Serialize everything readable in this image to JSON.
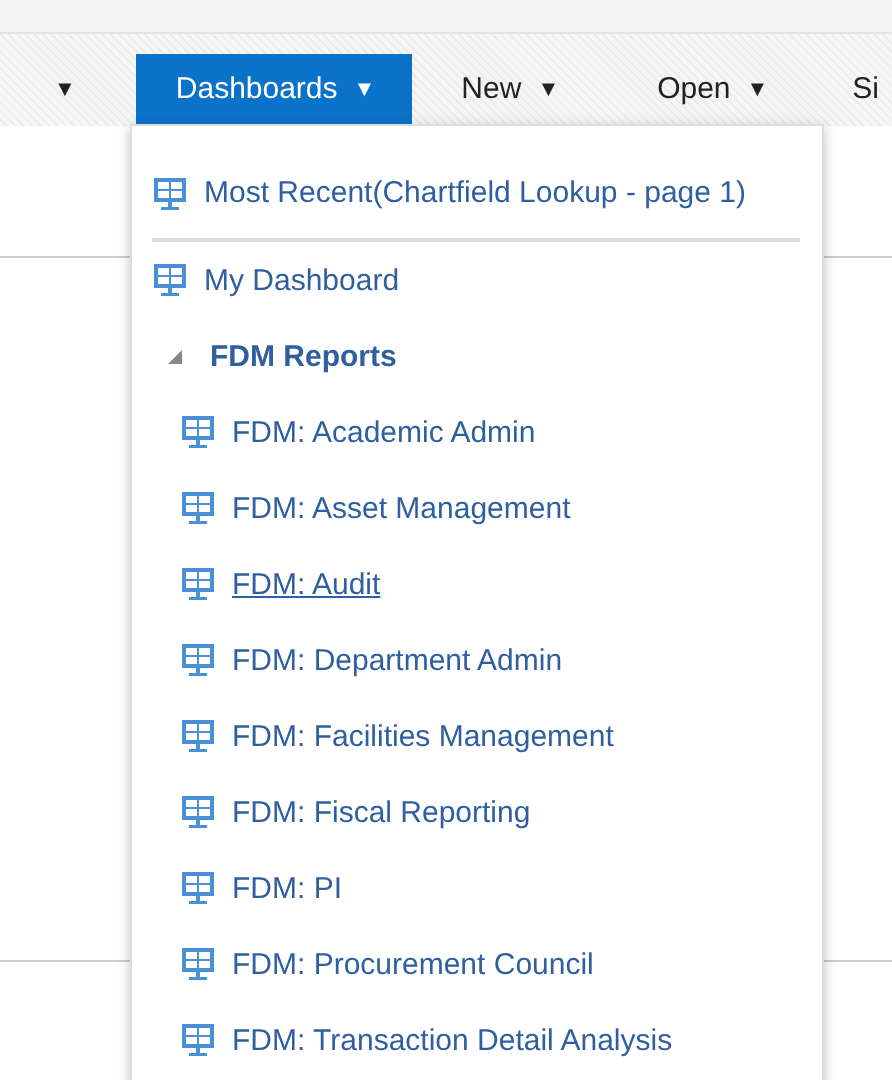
{
  "toolbar": {
    "items": [
      {
        "caret": "▼",
        "selected": false
      },
      {
        "label": "Dashboards",
        "caret": "▼",
        "selected": true
      },
      {
        "label": "New",
        "caret": "▼",
        "selected": false
      },
      {
        "label": "Open",
        "caret": "▼",
        "selected": false
      },
      {
        "label": "Si",
        "selected": false
      }
    ]
  },
  "dashboards_menu": {
    "recent": {
      "label": "Most Recent(Chartfield Lookup - page 1)"
    },
    "items": [
      {
        "kind": "dashboard",
        "label": "My Dashboard",
        "hovered": false
      },
      {
        "kind": "folder",
        "label": "FDM Reports",
        "expanded": true,
        "children": [
          {
            "kind": "dashboard",
            "label": "FDM: Academic Admin",
            "hovered": false
          },
          {
            "kind": "dashboard",
            "label": "FDM: Asset Management",
            "hovered": false
          },
          {
            "kind": "dashboard",
            "label": "FDM: Audit",
            "hovered": true
          },
          {
            "kind": "dashboard",
            "label": "FDM: Department Admin",
            "hovered": false
          },
          {
            "kind": "dashboard",
            "label": "FDM: Facilities Management",
            "hovered": false
          },
          {
            "kind": "dashboard",
            "label": "FDM: Fiscal Reporting",
            "hovered": false
          },
          {
            "kind": "dashboard",
            "label": "FDM: PI",
            "hovered": false
          },
          {
            "kind": "dashboard",
            "label": "FDM: Procurement Council",
            "hovered": false
          },
          {
            "kind": "dashboard",
            "label": "FDM: Transaction Detail Analysis",
            "hovered": false
          }
        ]
      }
    ]
  }
}
